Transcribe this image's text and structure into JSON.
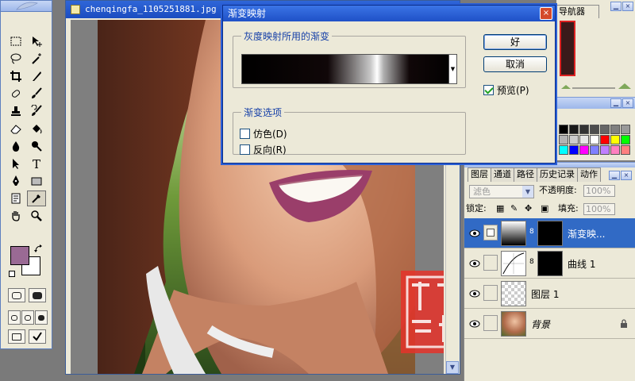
{
  "document": {
    "title": "chenqingfa_1105251881.jpg @ 6"
  },
  "dialog": {
    "title": "渐变映射",
    "close": "×",
    "gradient_group_label": "灰度映射所用的渐变",
    "options_group_label": "渐变选项",
    "dither_label": "仿色(D)",
    "reverse_label": "反向(R)",
    "ok_label": "好",
    "cancel_label": "取消",
    "preview_label": "预览(P)",
    "preview_checked": true,
    "dither_checked": false,
    "reverse_checked": false
  },
  "navigator": {
    "tab_label": "导航器"
  },
  "layers_panel": {
    "tabs": [
      "图层",
      "通道",
      "路径",
      "历史记录",
      "动作"
    ],
    "blend_mode": "滤色",
    "opacity_label": "不透明度:",
    "opacity_value": "100%",
    "lock_label": "锁定:",
    "fill_label": "填充:",
    "fill_value": "100%",
    "layers": [
      {
        "name": "渐变映...",
        "selected": true
      },
      {
        "name": "曲线 1",
        "selected": false
      },
      {
        "name": "图层 1",
        "selected": false
      },
      {
        "name": "背景",
        "selected": false
      }
    ]
  },
  "colors": {
    "foreground": "#9a6a94",
    "background": "#ffffff",
    "accent": "#316ac5",
    "title_bar": "#2f66d8"
  },
  "swatches": [
    "#000000",
    "#1a1a1a",
    "#333333",
    "#4d4d4d",
    "#666666",
    "#808080",
    "#999999",
    "#b3b3b3",
    "#cccccc",
    "#e6e6e6",
    "#ffffff",
    "#ff0000",
    "#ffff00",
    "#00ff00",
    "#00ffff",
    "#0000ff",
    "#ff00ff",
    "#8080ff",
    "#c080ff",
    "#ff80c0",
    "#ff8080"
  ],
  "icons": [
    "marquee-icon",
    "move-icon",
    "lasso-icon",
    "magic-wand-icon",
    "crop-icon",
    "slice-icon",
    "healing-brush-icon",
    "brush-icon",
    "clone-stamp-icon",
    "history-brush-icon",
    "eraser-icon",
    "paint-bucket-icon",
    "blur-icon",
    "dodge-icon",
    "path-select-icon",
    "type-icon",
    "pen-icon",
    "rectangle-icon",
    "notes-icon",
    "eyedropper-icon",
    "hand-icon",
    "zoom-icon"
  ]
}
